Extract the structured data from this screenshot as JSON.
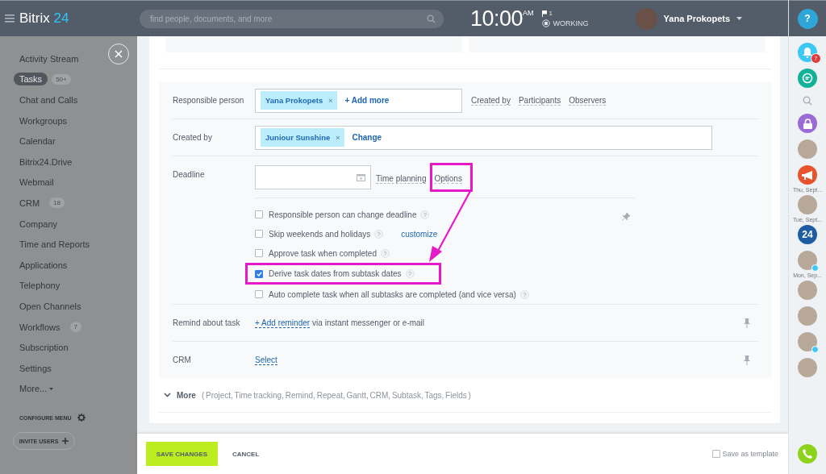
{
  "header": {
    "logo": {
      "name": "Bitrix",
      "accent": "24"
    },
    "search": {
      "placeholder": "find people, documents, and more"
    },
    "clock": {
      "time": "10:00",
      "period": "AM"
    },
    "flag_count": "1",
    "status": "WORKING",
    "user": "Yana Prokopets"
  },
  "sidebar": {
    "items": [
      {
        "label": "Activity Stream",
        "selected": false
      },
      {
        "label": "Tasks",
        "badge": "50+",
        "selected": true
      },
      {
        "label": "Chat and Calls",
        "selected": false
      },
      {
        "label": "Workgroups",
        "selected": false
      },
      {
        "label": "Calendar",
        "selected": false
      },
      {
        "label": "Bitrix24.Drive",
        "selected": false
      },
      {
        "label": "Webmail",
        "selected": false
      },
      {
        "label": "CRM",
        "badge": "18",
        "selected": false
      },
      {
        "label": "Company",
        "selected": false
      },
      {
        "label": "Time and Reports",
        "selected": false
      },
      {
        "label": "Applications",
        "selected": false
      },
      {
        "label": "Telephony",
        "selected": false
      },
      {
        "label": "Open Channels",
        "selected": false
      },
      {
        "label": "Workflows",
        "badge": "7",
        "selected": false
      },
      {
        "label": "Subscription",
        "selected": false
      },
      {
        "label": "Settings",
        "selected": false
      },
      {
        "label": "More...",
        "selected": false,
        "dropdown": true
      }
    ],
    "configure": "CONFIGURE MENU",
    "invite": "INVITE USERS"
  },
  "form": {
    "responsible": {
      "label": "Responsible person",
      "tags": [
        {
          "name": "Yana Prokopets",
          "remove": "×"
        }
      ],
      "add": "+ Add more",
      "links": [
        "Created by",
        "Participants",
        "Observers"
      ]
    },
    "created_by": {
      "label": "Created by",
      "tags": [
        {
          "name": "Juniour Sunshine",
          "remove": "×"
        }
      ],
      "change": "Change"
    },
    "deadline": {
      "label": "Deadline",
      "links": [
        {
          "label": "Time planning",
          "highlighted": false
        },
        {
          "label": "Options",
          "highlighted": true
        }
      ],
      "options": [
        {
          "label": "Responsible person can change deadline",
          "help": "?",
          "checked": false,
          "highlighted": false
        },
        {
          "label": "Skip weekends and holidays",
          "help": "?",
          "link": "customize",
          "checked": false,
          "highlighted": false
        },
        {
          "label": "Approve task when completed",
          "help": "?",
          "checked": false,
          "highlighted": false
        },
        {
          "label": "Derive task dates from subtask dates",
          "help": "?",
          "checked": true,
          "highlighted": true
        },
        {
          "label": "Auto complete task when all subtasks are completed (and vice versa)",
          "help": "?",
          "checked": false,
          "highlighted": false
        }
      ]
    },
    "remind": {
      "label": "Remind about task",
      "link": "+ Add reminder",
      "text": "via instant messenger or e-mail"
    },
    "crm": {
      "label": "CRM",
      "link": "Select"
    },
    "more": {
      "label": "More",
      "sections": "( Project,  Time tracking,  Remind,  Repeat,  Gantt,  CRM,  Subtask,  Tags,  Fields )"
    }
  },
  "footer": {
    "save": "SAVE CHANGES",
    "cancel": "CANCEL",
    "template": {
      "label": "Save as template",
      "checked": false
    }
  },
  "rail": [
    {
      "kind": "bell",
      "badge": "7"
    },
    {
      "kind": "chat"
    },
    {
      "kind": "search"
    },
    {
      "kind": "lock"
    },
    {
      "kind": "avatar",
      "online": false
    },
    {
      "kind": "megaphone"
    },
    {
      "kind": "date",
      "text": "Thu, Sept..."
    },
    {
      "kind": "avatar",
      "online": false
    },
    {
      "kind": "date",
      "text": "Tue, Sept..."
    },
    {
      "kind": "logo",
      "text": "24"
    },
    {
      "kind": "avatar",
      "online": true
    },
    {
      "kind": "date",
      "text": "Mon, Sep..."
    },
    {
      "kind": "avatar",
      "online": false
    },
    {
      "kind": "avatar",
      "online": false
    },
    {
      "kind": "avatar",
      "online": true
    },
    {
      "kind": "avatar",
      "online": false
    }
  ],
  "help": "?"
}
